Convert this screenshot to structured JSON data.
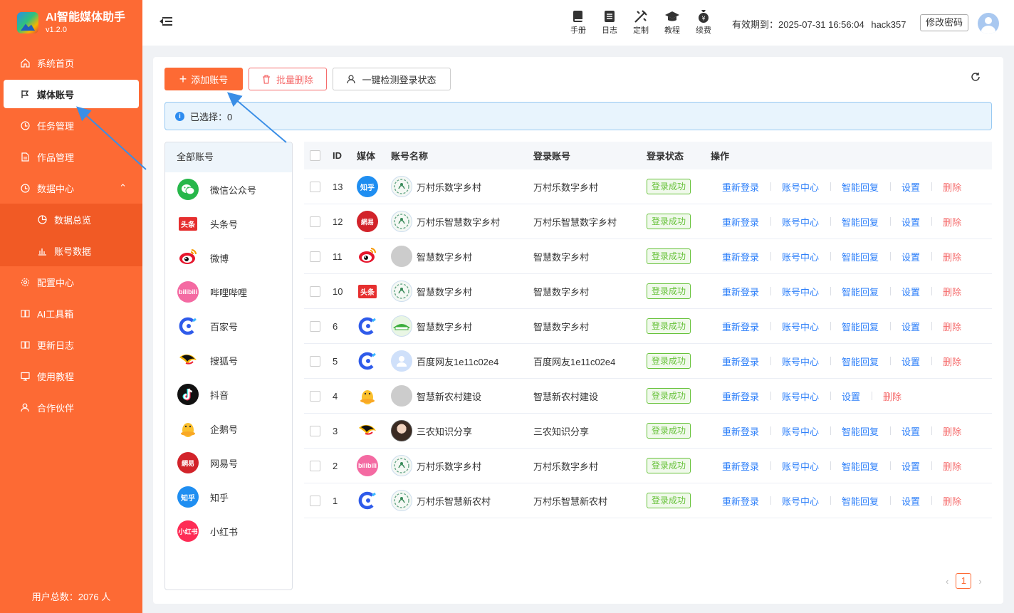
{
  "app": {
    "title": "AI智能媒体助手",
    "version": "v1.2.0"
  },
  "sidebar": {
    "items": [
      {
        "label": "系统首页",
        "icon": "home-icon"
      },
      {
        "label": "媒体账号",
        "icon": "flag-icon",
        "active": true
      },
      {
        "label": "任务管理",
        "icon": "clock-icon"
      },
      {
        "label": "作品管理",
        "icon": "file-icon"
      },
      {
        "label": "数据中心",
        "icon": "clock-icon",
        "expanded": true
      },
      {
        "label": "数据总览",
        "icon": "pie-icon",
        "sub": true
      },
      {
        "label": "账号数据",
        "icon": "bar-chart-icon",
        "sub": true
      },
      {
        "label": "配置中心",
        "icon": "gear-icon"
      },
      {
        "label": "AI工具箱",
        "icon": "book-icon"
      },
      {
        "label": "更新日志",
        "icon": "book-icon"
      },
      {
        "label": "使用教程",
        "icon": "monitor-icon"
      },
      {
        "label": "合作伙伴",
        "icon": "user-icon"
      }
    ],
    "user_count": "用户总数：2076 人"
  },
  "header": {
    "tools": [
      {
        "label": "手册",
        "icon": "manual-icon"
      },
      {
        "label": "日志",
        "icon": "log-icon"
      },
      {
        "label": "定制",
        "icon": "custom-icon"
      },
      {
        "label": "教程",
        "icon": "graduation-cap-icon"
      },
      {
        "label": "续费",
        "icon": "money-bag-icon"
      }
    ],
    "expire": "有效期到：2025-07-31 16:56:04",
    "username": "hack357",
    "change_password": "修改密码"
  },
  "toolbar": {
    "add": "添加账号",
    "batch_delete": "批量删除",
    "check_login": "一键检测登录状态"
  },
  "alert": {
    "selected": "已选择：0"
  },
  "media_list": {
    "header": "全部账号",
    "items": [
      {
        "label": "微信公众号",
        "icon": "wechat"
      },
      {
        "label": "头条号",
        "icon": "toutiao"
      },
      {
        "label": "微博",
        "icon": "weibo"
      },
      {
        "label": "哔哩哔哩",
        "icon": "bilibili"
      },
      {
        "label": "百家号",
        "icon": "baijia"
      },
      {
        "label": "搜狐号",
        "icon": "sohu"
      },
      {
        "label": "抖音",
        "icon": "douyin"
      },
      {
        "label": "企鹅号",
        "icon": "qie"
      },
      {
        "label": "网易号",
        "icon": "wangyi"
      },
      {
        "label": "知乎",
        "icon": "zhihu"
      },
      {
        "label": "小红书",
        "icon": "xiaohongshu"
      }
    ]
  },
  "table": {
    "headers": {
      "id": "ID",
      "media": "媒体",
      "name": "账号名称",
      "account": "登录账号",
      "status": "登录状态",
      "ops": "操作"
    },
    "rows": [
      {
        "id": "13",
        "media": "zhihu",
        "name": "万村乐数字乡村",
        "account": "万村乐数字乡村",
        "status": "登录成功",
        "avatar": "logo",
        "ops": [
          "重新登录",
          "账号中心",
          "智能回复",
          "设置",
          "删除"
        ]
      },
      {
        "id": "12",
        "media": "wangyi",
        "name": "万村乐智慧数字乡村",
        "account": "万村乐智慧数字乡村",
        "status": "登录成功",
        "avatar": "logo",
        "ops": [
          "重新登录",
          "账号中心",
          "智能回复",
          "设置",
          "删除"
        ]
      },
      {
        "id": "11",
        "media": "weibo",
        "name": "智慧数字乡村",
        "account": "智慧数字乡村",
        "status": "登录成功",
        "avatar": "gray",
        "ops": [
          "重新登录",
          "账号中心",
          "智能回复",
          "设置",
          "删除"
        ]
      },
      {
        "id": "10",
        "media": "toutiao",
        "name": "智慧数字乡村",
        "account": "智慧数字乡村",
        "status": "登录成功",
        "avatar": "logo",
        "ops": [
          "重新登录",
          "账号中心",
          "智能回复",
          "设置",
          "删除"
        ]
      },
      {
        "id": "6",
        "media": "baijia",
        "name": "智慧数字乡村",
        "account": "智慧数字乡村",
        "status": "登录成功",
        "avatar": "green",
        "ops": [
          "重新登录",
          "账号中心",
          "智能回复",
          "设置",
          "删除"
        ]
      },
      {
        "id": "5",
        "media": "baijia",
        "name": "百度网友1e11c02e4",
        "account": "百度网友1e11c02e4",
        "status": "登录成功",
        "avatar": "blue",
        "ops": [
          "重新登录",
          "账号中心",
          "智能回复",
          "设置",
          "删除"
        ]
      },
      {
        "id": "4",
        "media": "qie",
        "name": "智慧新农村建设",
        "account": "智慧新农村建设",
        "status": "登录成功",
        "avatar": "gray",
        "ops": [
          "重新登录",
          "账号中心",
          "设置",
          "删除"
        ]
      },
      {
        "id": "3",
        "media": "sohu",
        "name": "三农知识分享",
        "account": "三农知识分享",
        "status": "登录成功",
        "avatar": "photo",
        "ops": [
          "重新登录",
          "账号中心",
          "智能回复",
          "设置",
          "删除"
        ]
      },
      {
        "id": "2",
        "media": "bilibili",
        "name": "万村乐数字乡村",
        "account": "万村乐数字乡村",
        "status": "登录成功",
        "avatar": "logo",
        "ops": [
          "重新登录",
          "账号中心",
          "智能回复",
          "设置",
          "删除"
        ]
      },
      {
        "id": "1",
        "media": "baijia",
        "name": "万村乐智慧新农村",
        "account": "万村乐智慧新农村",
        "status": "登录成功",
        "avatar": "logo",
        "ops": [
          "重新登录",
          "账号中心",
          "智能回复",
          "设置",
          "删除"
        ]
      }
    ]
  },
  "pagination": {
    "current": "1",
    "prev": "‹",
    "next": "›"
  },
  "colors": {
    "brand": "#fd6a34",
    "link": "#2d7ff9",
    "danger": "#f56c6c",
    "success": "#67c23a"
  }
}
